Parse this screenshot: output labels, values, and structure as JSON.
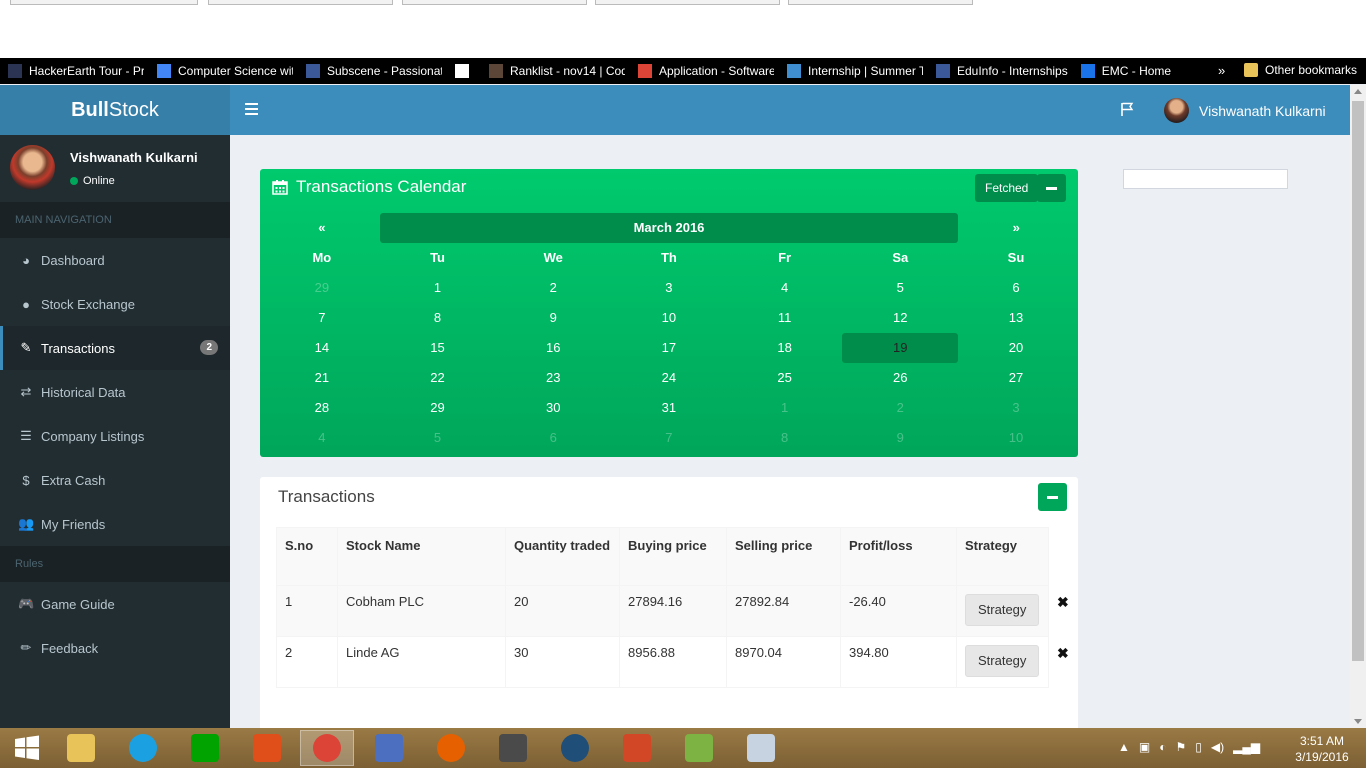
{
  "bookmarks": [
    {
      "label": "HackerEarth Tour - Pr",
      "icon": "hackerearth-icon",
      "color": "#2c3454"
    },
    {
      "label": "Computer Science wit",
      "icon": "google-icon",
      "color": "#4285f4"
    },
    {
      "label": "Subscene - Passionate",
      "icon": "subscene-icon",
      "color": "#3b5998"
    },
    {
      "label": "",
      "icon": "blank-page-icon",
      "color": "#ffffff"
    },
    {
      "label": "Ranklist - nov14 | Cod",
      "icon": "codechef-icon",
      "color": "#5b4638"
    },
    {
      "label": "Application - Software",
      "icon": "chrome-icon",
      "color": "#db4437"
    },
    {
      "label": "Internship | Summer T",
      "icon": "internshala-icon",
      "color": "#3e8ed0"
    },
    {
      "label": "EduInfo - Internships",
      "icon": "facebook-icon",
      "color": "#3b5998"
    },
    {
      "label": "EMC - Home",
      "icon": "emc-icon",
      "color": "#1a73e8"
    }
  ],
  "bookmarks_overflow": "»",
  "other_bookmarks": "Other bookmarks",
  "app": {
    "logo_bold": "Bull",
    "logo_rest": "Stock",
    "header_user": "Vishwanath Kulkarni"
  },
  "sidebar": {
    "user_name": "Vishwanath Kulkarni",
    "status": "Online",
    "main_header": "MAIN NAVIGATION",
    "items": [
      {
        "label": "Dashboard",
        "icon": "dashboard-icon",
        "glyph": "◕"
      },
      {
        "label": "Stock Exchange",
        "icon": "globe-icon",
        "glyph": "●"
      },
      {
        "label": "Transactions",
        "icon": "edit-icon",
        "glyph": "✎",
        "badge": "2"
      },
      {
        "label": "Historical Data",
        "icon": "exchange-icon",
        "glyph": "⇄"
      },
      {
        "label": "Company Listings",
        "icon": "list-icon",
        "glyph": "☰"
      },
      {
        "label": "Extra Cash",
        "icon": "dollar-icon",
        "glyph": "$"
      },
      {
        "label": "My Friends",
        "icon": "users-icon",
        "glyph": "👥"
      }
    ],
    "rules_header": "Rules",
    "rule_items": [
      {
        "label": "Game Guide",
        "icon": "gamepad-icon",
        "glyph": "🎮"
      },
      {
        "label": "Feedback",
        "icon": "pencil-icon",
        "glyph": "✏"
      }
    ]
  },
  "calendar": {
    "title": "Transactions Calendar",
    "fetched_label": "Fetched",
    "prev": "«",
    "next": "»",
    "month": "March 2016",
    "days": [
      "Mo",
      "Tu",
      "We",
      "Th",
      "Fr",
      "Sa",
      "Su"
    ],
    "weeks": [
      [
        "29",
        "1",
        "2",
        "3",
        "4",
        "5",
        "6"
      ],
      [
        "7",
        "8",
        "9",
        "10",
        "11",
        "12",
        "13"
      ],
      [
        "14",
        "15",
        "16",
        "17",
        "18",
        "19",
        "20"
      ],
      [
        "21",
        "22",
        "23",
        "24",
        "25",
        "26",
        "27"
      ],
      [
        "28",
        "29",
        "30",
        "31",
        "1",
        "2",
        "3"
      ],
      [
        "4",
        "5",
        "6",
        "7",
        "8",
        "9",
        "10"
      ]
    ],
    "today": "19",
    "colors": {
      "box": "#00a65a",
      "dark": "#008d4c"
    }
  },
  "transactions": {
    "title": "Transactions",
    "columns": [
      "S.no",
      "Stock Name",
      "Quantity traded",
      "Buying price",
      "Selling price",
      "Profit/loss",
      "Strategy"
    ],
    "rows": [
      [
        "1",
        "Cobham PLC",
        "20",
        "27894.16",
        "27892.84",
        "-26.40"
      ],
      [
        "2",
        "Linde AG",
        "30",
        "8956.88",
        "8970.04",
        "394.80"
      ]
    ],
    "strategy_label": "Strategy",
    "delete_glyph": "✖"
  },
  "taskbar": {
    "apps": [
      {
        "icon": "windows-start-icon",
        "color": "#ffffff"
      },
      {
        "icon": "file-explorer-icon",
        "color": "#e8c35a"
      },
      {
        "icon": "internet-explorer-icon",
        "color": "#1ba1e2"
      },
      {
        "icon": "windows-store-icon",
        "color": "#00a300"
      },
      {
        "icon": "ms-office-icon",
        "color": "#e04e1a"
      },
      {
        "icon": "chrome-icon",
        "color": "#db4437"
      },
      {
        "icon": "media-player-icon",
        "color": "#4c6fbf"
      },
      {
        "icon": "firefox-icon",
        "color": "#e66000"
      },
      {
        "icon": "game-icon",
        "color": "#4a4a4a"
      },
      {
        "icon": "network-app-icon",
        "color": "#1f4e79"
      },
      {
        "icon": "powerpoint-icon",
        "color": "#d24726"
      },
      {
        "icon": "notepad-plus-icon",
        "color": "#7cb342"
      },
      {
        "icon": "paint-icon",
        "color": "#c7d3e0"
      }
    ],
    "time": "3:51 AM",
    "date": "3/19/2016"
  }
}
